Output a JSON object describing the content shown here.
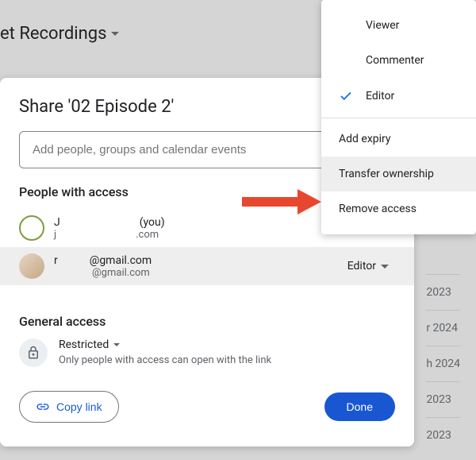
{
  "background": {
    "title": "et Recordings",
    "dates": [
      "2023",
      "r 2024",
      "h 2024",
      "2023",
      "2023"
    ]
  },
  "dialog": {
    "title": "Share '02 Episode 2'",
    "add_placeholder": "Add people, groups and calendar events",
    "people_label": "People with access",
    "people": [
      {
        "name": "J",
        "you": "(you)",
        "email": "j",
        "domain": ".com"
      },
      {
        "name": "r",
        "domain_line1": "@gmail.com",
        "domain_line2": "@gmail.com",
        "role": "Editor"
      }
    ],
    "general_label": "General access",
    "restricted": "Restricted",
    "restricted_desc": "Only people with access can open with the link",
    "copy_link": "Copy link",
    "done": "Done"
  },
  "menu": {
    "viewer": "Viewer",
    "commenter": "Commenter",
    "editor": "Editor",
    "add_expiry": "Add expiry",
    "transfer": "Transfer ownership",
    "remove": "Remove access"
  }
}
